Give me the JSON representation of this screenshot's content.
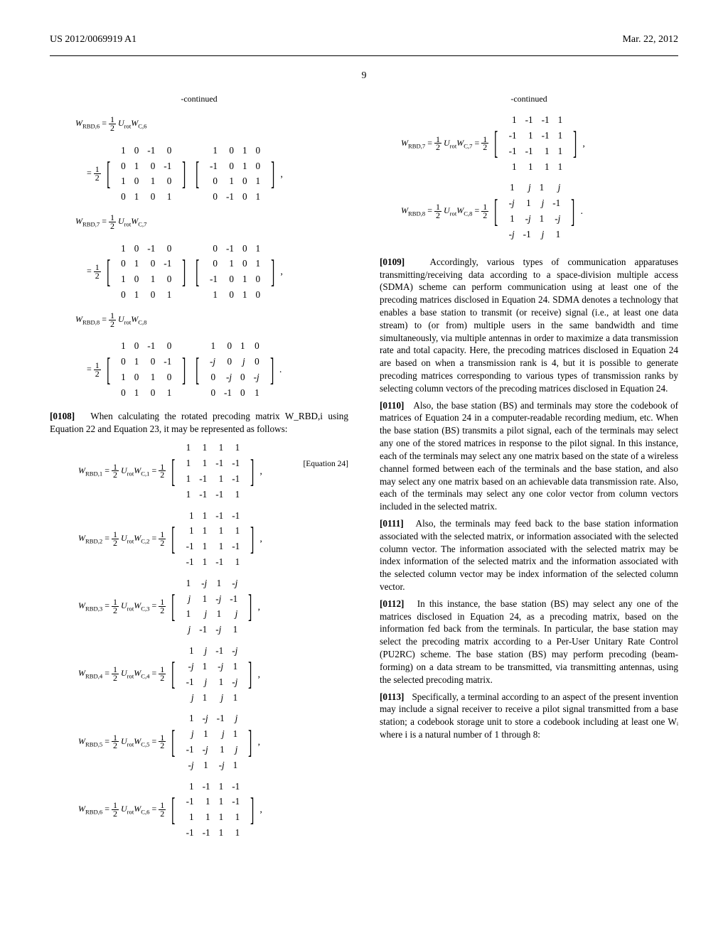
{
  "header": {
    "pub_number": "US 2012/0069919 A1",
    "pub_date": "Mar. 22, 2012"
  },
  "page_number": "9",
  "left": {
    "continued": "-continued",
    "intro_para": {
      "num": "[0108]",
      "text": "When calculating the rotated precoding matrix W_RBD,i using Equation 22 and Equation 23, it may be represented as follows:"
    },
    "eq_tag": "[Equation 24]",
    "matrices_unrot": [
      {
        "name": "W_RBD,6",
        "rhs": "½ U_rot W_C,6",
        "left": [
          [
            "1",
            "0",
            "-1",
            "0"
          ],
          [
            "0",
            "1",
            "0",
            "-1"
          ],
          [
            "1",
            "0",
            "1",
            "0"
          ],
          [
            "0",
            "1",
            "0",
            "1"
          ]
        ],
        "right": [
          [
            "1",
            "0",
            "1",
            "0"
          ],
          [
            "-1",
            "0",
            "1",
            "0"
          ],
          [
            "0",
            "1",
            "0",
            "1"
          ],
          [
            "0",
            "-1",
            "0",
            "1"
          ]
        ]
      },
      {
        "name": "W_RBD,7",
        "rhs": "½ U_rot W_C,7",
        "left": [
          [
            "1",
            "0",
            "-1",
            "0"
          ],
          [
            "0",
            "1",
            "0",
            "-1"
          ],
          [
            "1",
            "0",
            "1",
            "0"
          ],
          [
            "0",
            "1",
            "0",
            "1"
          ]
        ],
        "right": [
          [
            "0",
            "-1",
            "0",
            "1"
          ],
          [
            "0",
            "1",
            "0",
            "1"
          ],
          [
            "-1",
            "0",
            "1",
            "0"
          ],
          [
            "1",
            "0",
            "1",
            "0"
          ]
        ]
      },
      {
        "name": "W_RBD,8",
        "rhs": "½ U_rot W_C,8",
        "left": [
          [
            "1",
            "0",
            "-1",
            "0"
          ],
          [
            "0",
            "1",
            "0",
            "-1"
          ],
          [
            "1",
            "0",
            "1",
            "0"
          ],
          [
            "0",
            "1",
            "0",
            "1"
          ]
        ],
        "right": [
          [
            "1",
            "0",
            "1",
            "0"
          ],
          [
            "-j",
            "0",
            "j",
            "0"
          ],
          [
            "0",
            "-j",
            "0",
            "-j"
          ],
          [
            "0",
            "-1",
            "0",
            "1"
          ]
        ]
      }
    ],
    "matrices_result": [
      {
        "name": "W_RBD,1",
        "rhs": "½ U_rot W_C,1",
        "m": [
          [
            "1",
            "1",
            "1",
            "1"
          ],
          [
            "1",
            "1",
            "-1",
            "-1"
          ],
          [
            "1",
            "-1",
            "1",
            "-1"
          ],
          [
            "1",
            "-1",
            "-1",
            "1"
          ]
        ]
      },
      {
        "name": "W_RBD,2",
        "rhs": "½ U_rot W_C,2",
        "m": [
          [
            "1",
            "1",
            "-1",
            "-1"
          ],
          [
            "1",
            "1",
            "1",
            "1"
          ],
          [
            "-1",
            "1",
            "1",
            "-1"
          ],
          [
            "-1",
            "1",
            "-1",
            "1"
          ]
        ]
      },
      {
        "name": "W_RBD,3",
        "rhs": "½ U_rot W_C,3",
        "m": [
          [
            "1",
            "-j",
            "1",
            "-j"
          ],
          [
            "j",
            "1",
            "-j",
            "-1"
          ],
          [
            "1",
            "j",
            "1",
            "j"
          ],
          [
            "j",
            "-1",
            "-j",
            "1"
          ]
        ]
      },
      {
        "name": "W_RBD,4",
        "rhs": "½ U_rot W_C,4",
        "m": [
          [
            "1",
            "j",
            "-1",
            "-j"
          ],
          [
            "-j",
            "1",
            "-j",
            "1"
          ],
          [
            "-1",
            "j",
            "1",
            "-j"
          ],
          [
            "j",
            "1",
            "j",
            "1"
          ]
        ]
      },
      {
        "name": "W_RBD,5",
        "rhs": "½ U_rot W_C,5",
        "m": [
          [
            "1",
            "-j",
            "-1",
            "j"
          ],
          [
            "j",
            "1",
            "j",
            "1"
          ],
          [
            "-1",
            "-j",
            "1",
            "j"
          ],
          [
            "-j",
            "1",
            "-j",
            "1"
          ]
        ]
      },
      {
        "name": "W_RBD,6",
        "rhs": "½ U_rot W_C,6",
        "m": [
          [
            "1",
            "-1",
            "1",
            "-1"
          ],
          [
            "-1",
            "1",
            "1",
            "-1"
          ],
          [
            "1",
            "1",
            "1",
            "1"
          ],
          [
            "-1",
            "-1",
            "1",
            "1"
          ]
        ]
      }
    ]
  },
  "right": {
    "continued": "-continued",
    "matrices_result": [
      {
        "name": "W_RBD,7",
        "rhs": "½ U_rot W_C,7",
        "m": [
          [
            "1",
            "-1",
            "-1",
            "1"
          ],
          [
            "-1",
            "1",
            "-1",
            "1"
          ],
          [
            "-1",
            "-1",
            "1",
            "1"
          ],
          [
            "1",
            "1",
            "1",
            "1"
          ]
        ]
      },
      {
        "name": "W_RBD,8",
        "rhs": "½ U_rot W_C,8",
        "m": [
          [
            "1",
            "j",
            "1",
            "j"
          ],
          [
            "-j",
            "1",
            "j",
            "-1"
          ],
          [
            "1",
            "-j",
            "1",
            "-j"
          ],
          [
            "-j",
            "-1",
            "j",
            "1"
          ]
        ]
      }
    ],
    "paras": [
      {
        "num": "[0109]",
        "text": "Accordingly, various types of communication apparatuses transmitting/receiving data according to a space-division multiple access (SDMA) scheme can perform communication using at least one of the precoding matrices disclosed in Equation 24. SDMA denotes a technology that enables a base station to transmit (or receive) signal (i.e., at least one data stream) to (or from) multiple users in the same bandwidth and time simultaneously, via multiple antennas in order to maximize a data transmission rate and total capacity. Here, the precoding matrices disclosed in Equation 24 are based on when a transmission rank is 4, but it is possible to generate precoding matrices corresponding to various types of transmission ranks by selecting column vectors of the precoding matrices disclosed in Equation 24."
      },
      {
        "num": "[0110]",
        "text": "Also, the base station (BS) and terminals may store the codebook of matrices of Equation 24 in a computer-readable recording medium, etc. When the base station (BS) transmits a pilot signal, each of the terminals may select any one of the stored matrices in response to the pilot signal. In this instance, each of the terminals may select any one matrix based on the state of a wireless channel formed between each of the terminals and the base station, and also may select any one matrix based on an achievable data transmission rate. Also, each of the terminals may select any one color vector from column vectors included in the selected matrix."
      },
      {
        "num": "[0111]",
        "text": "Also, the terminals may feed back to the base station information associated with the selected matrix, or information associated with the selected column vector. The information associated with the selected matrix may be index information of the selected matrix and the information associated with the selected column vector may be index information of the selected column vector."
      },
      {
        "num": "[0112]",
        "text": "In this instance, the base station (BS) may select any one of the matrices disclosed in Equation 24, as a precoding matrix, based on the information fed back from the terminals. In particular, the base station may select the precoding matrix according to a Per-User Unitary Rate Control (PU2RC) scheme. The base station (BS) may perform precoding (beam-forming) on a data stream to be transmitted, via transmitting antennas, using the selected precoding matrix."
      },
      {
        "num": "[0113]",
        "text": "Specifically, a terminal according to an aspect of the present invention may include a signal receiver to receive a pilot signal transmitted from a base station; a codebook storage unit to store a codebook including at least one Wᵢ where i is a natural number of 1 through 8:"
      }
    ]
  }
}
